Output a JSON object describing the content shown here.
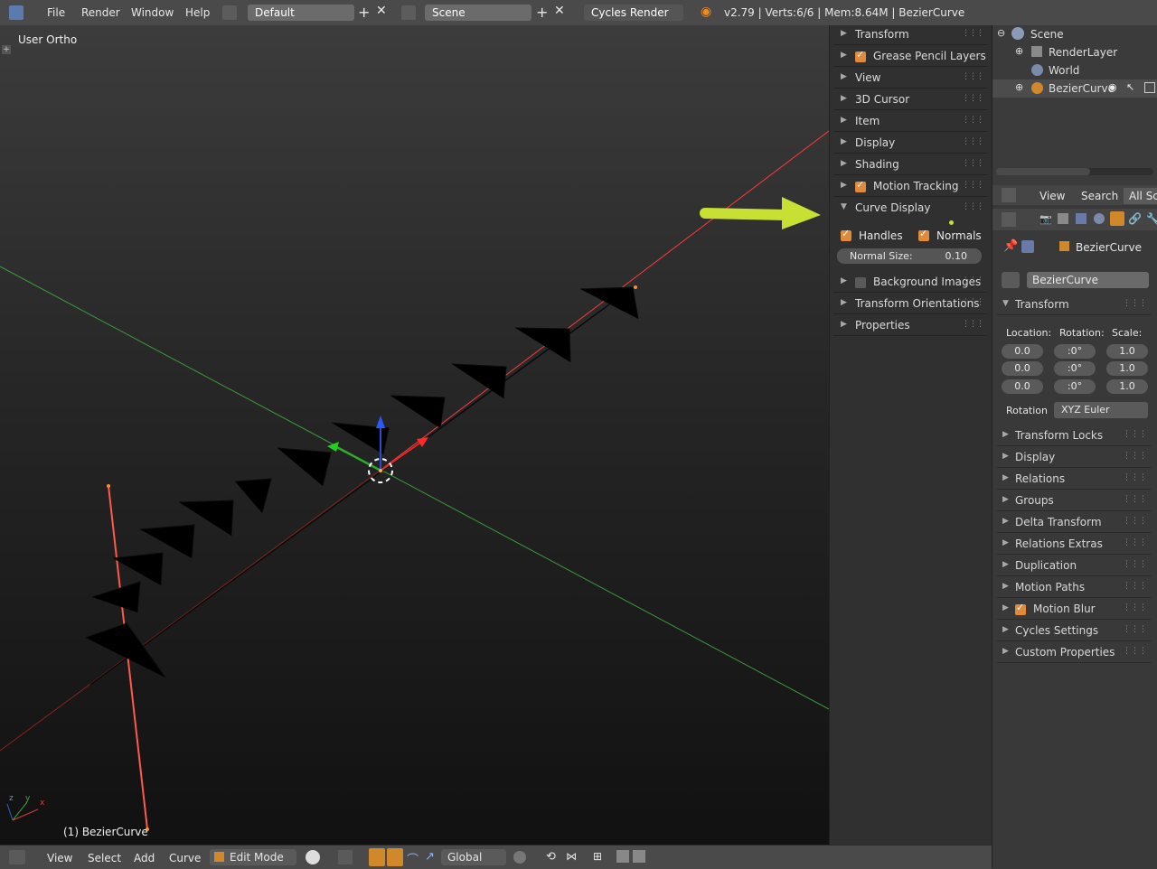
{
  "topbar": {
    "menus": [
      "File",
      "Render",
      "Window",
      "Help"
    ],
    "layout": "Default",
    "scene": "Scene",
    "engine": "Cycles Render",
    "status": "v2.79 | Verts:6/6 | Mem:8.64M | BezierCurve"
  },
  "viewport": {
    "view_label": "User Ortho",
    "object_label": "(1) BezierCurve",
    "axis_x": "x",
    "axis_y": "y",
    "axis_z": "z"
  },
  "npanel": {
    "panels": [
      "Transform",
      "Grease Pencil Layers",
      "View",
      "3D Cursor",
      "Item",
      "Display",
      "Shading",
      "Motion Tracking"
    ],
    "curve_display": {
      "title": "Curve Display",
      "handles": "Handles",
      "normals": "Normals",
      "normal_size_label": "Normal Size:",
      "normal_size_value": "0.10"
    },
    "panels_after": [
      "Background Images",
      "Transform Orientations",
      "Properties"
    ]
  },
  "outliner": {
    "items": [
      "Scene",
      "RenderLayer",
      "World",
      "BezierCurve"
    ]
  },
  "props_header": {
    "view": "View",
    "search": "Search",
    "filter": "All Sc"
  },
  "properties": {
    "object_name_crumb": "BezierCurve",
    "object_name_field": "BezierCurve",
    "transform": {
      "title": "Transform",
      "location_label": "Location:",
      "rotation_label": "Rotation:",
      "scale_label": "Scale:",
      "location": [
        "0.0",
        "0.0",
        "0.0"
      ],
      "rotation": [
        ":0°",
        ":0°",
        ":0°"
      ],
      "scale": [
        "1.0",
        "1.0",
        "1.0"
      ],
      "rotation_mode_label": "Rotation",
      "rotation_mode": "XYZ Euler"
    },
    "panels": [
      "Transform Locks",
      "Display",
      "Relations",
      "Groups",
      "Delta Transform",
      "Relations Extras",
      "Duplication",
      "Motion Paths",
      "Motion Blur",
      "Cycles Settings",
      "Custom Properties"
    ]
  },
  "bottombar": {
    "menus": [
      "View",
      "Select",
      "Add",
      "Curve"
    ],
    "mode": "Edit Mode",
    "orientation": "Global"
  },
  "colors": {
    "accent": "#e08a3c",
    "annotation_arrow": "#c8e033"
  }
}
